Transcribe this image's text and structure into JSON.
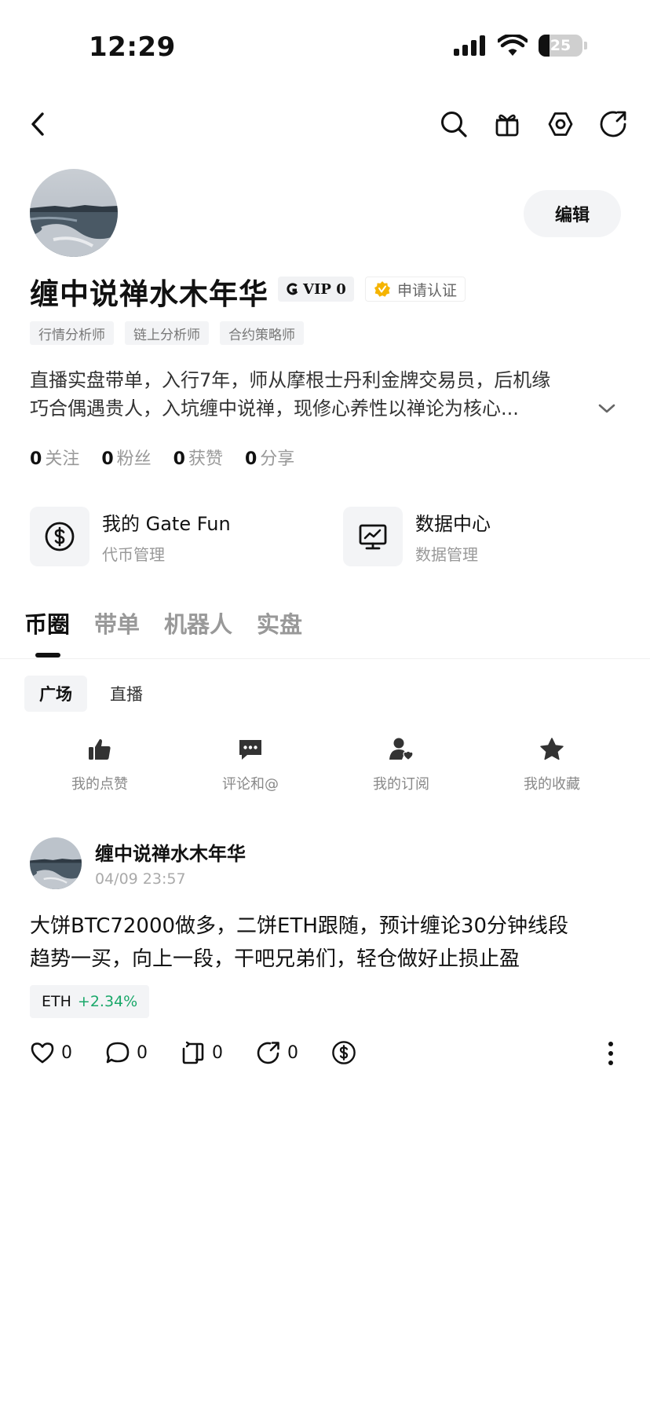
{
  "status_bar": {
    "time": "12:29",
    "battery": "25"
  },
  "profile": {
    "edit_label": "编辑",
    "username": "缠中说禅水木年华",
    "vip_label": "VIP 0",
    "verify_label": "申请认证",
    "tags": [
      "行情分析师",
      "链上分析师",
      "合约策略师"
    ],
    "bio_line1": "直播实盘带单，入行7年，师从摩根士丹利金牌交易员，后机缘",
    "bio_line2": "巧合偶遇贵人，入坑缠中说禅，现修心养性以禅论为核心...",
    "stats": [
      {
        "value": "0",
        "label": "关注"
      },
      {
        "value": "0",
        "label": "粉丝"
      },
      {
        "value": "0",
        "label": "获赞"
      },
      {
        "value": "0",
        "label": "分享"
      }
    ]
  },
  "features": [
    {
      "title": "我的 Gate Fun",
      "subtitle": "代币管理",
      "icon": "dollar-circle-icon"
    },
    {
      "title": "数据中心",
      "subtitle": "数据管理",
      "icon": "chart-monitor-icon"
    }
  ],
  "main_tabs": [
    "币圈",
    "带单",
    "机器人",
    "实盘"
  ],
  "sub_tabs": [
    "广场",
    "直播"
  ],
  "quick_actions": [
    {
      "label": "我的点赞",
      "icon": "thumbs-up-icon"
    },
    {
      "label": "评论和@",
      "icon": "comment-icon"
    },
    {
      "label": "我的订阅",
      "icon": "subscribe-user-icon"
    },
    {
      "label": "我的收藏",
      "icon": "star-icon"
    }
  ],
  "post": {
    "author": "缠中说禅水木年华",
    "time": "04/09 23:57",
    "text_line1": "大饼BTC72000做多，二饼ETH跟随，预计缠论30分钟线段",
    "text_line2": "趋势一买，向上一段，干吧兄弟们，轻仓做好止损止盈",
    "coin": "ETH",
    "change": "+2.34%",
    "likes": "0",
    "comments": "0",
    "reposts": "0",
    "shares": "0"
  },
  "colors": {
    "accent_green": "#1aa86a",
    "gold": "#f5b400"
  }
}
